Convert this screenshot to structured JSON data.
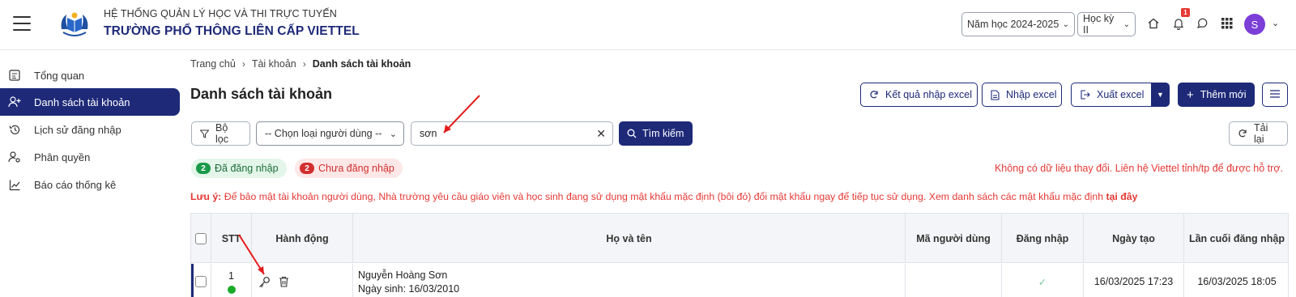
{
  "header": {
    "system_name": "HỆ THỐNG QUẢN LÝ HỌC VÀ THI TRỰC TUYẾN",
    "school_name": "TRƯỜNG PHỔ THÔNG LIÊN CẤP VIETTEL",
    "school_year_select": "Năm học 2024-2025",
    "semester_select": "Học kỳ II",
    "notification_count": "1",
    "avatar_letter": "S"
  },
  "sidebar": {
    "items": [
      {
        "label": "Tổng quan",
        "icon": "dashboard-icon",
        "active": false
      },
      {
        "label": "Danh sách tài khoản",
        "icon": "user-plus-icon",
        "active": true
      },
      {
        "label": "Lịch sử đăng nhập",
        "icon": "history-icon",
        "active": false
      },
      {
        "label": "Phân quyền",
        "icon": "user-settings-icon",
        "active": false
      },
      {
        "label": "Báo cáo thống kê",
        "icon": "chart-line-icon",
        "active": false
      }
    ]
  },
  "breadcrumb": {
    "items": [
      "Trang chủ",
      "Tài khoản",
      "Danh sách tài khoản"
    ]
  },
  "page_title": "Danh sách tài khoản",
  "toolbar": {
    "import_result": "Kết quả nhập excel",
    "import_excel": "Nhập excel",
    "export_excel": "Xuất excel",
    "add_new": "Thêm mới"
  },
  "filters": {
    "filter_label": "Bộ lọc",
    "user_type_select": "-- Chọn loại người dùng --",
    "search_value": "sơn",
    "search_button": "Tìm kiếm",
    "reload_button": "Tải lại"
  },
  "status_chips": {
    "logged_in_count": "2",
    "logged_in_label": "Đã đăng nhập",
    "not_logged_in_count": "2",
    "not_logged_in_label": "Chưa đăng nhập"
  },
  "no_data_message": "Không có dữ liệu thay đổi. Liên hệ Viettel tỉnh/tp để được hỗ trợ.",
  "warning": {
    "prefix": "Lưu ý:",
    "text": " Để bảo mật tài khoản người dùng, Nhà trường yêu cầu giáo viên và học sinh đang sử dụng mật khẩu mặc định (bôi đỏ) đổi mật khẩu ngay để tiếp tục sử dụng. Xem danh sách các mật khẩu mặc định ",
    "link": "tại đây"
  },
  "table": {
    "columns": [
      "STT",
      "Hành động",
      "Họ và tên",
      "Mã người dùng",
      "Đăng nhập",
      "Ngày tạo",
      "Lần cuối đăng nhập"
    ],
    "rows": [
      {
        "stt": "1",
        "name": "Nguyễn Hoàng Sơn",
        "dob": "Ngày sinh: 16/03/2010",
        "user_code": "",
        "logged_in": "✓",
        "created": "16/03/2025 17:23",
        "last_login": "16/03/2025 18:05"
      }
    ]
  },
  "colors": {
    "brand": "#1e2a78",
    "danger": "#e53935",
    "success": "#1a9a4a"
  }
}
